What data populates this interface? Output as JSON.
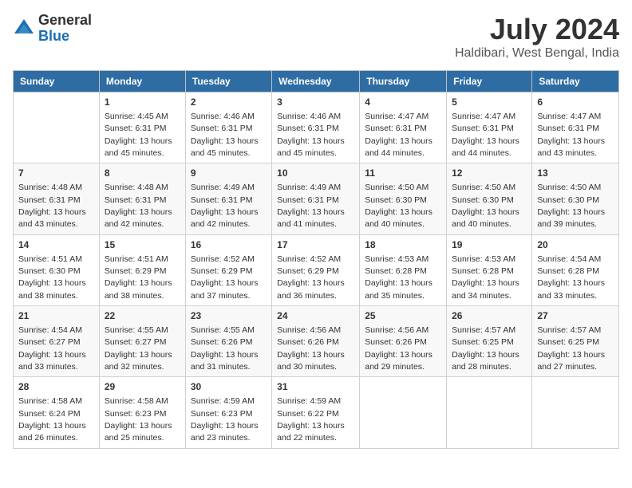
{
  "logo": {
    "general": "General",
    "blue": "Blue"
  },
  "title": "July 2024",
  "location": "Haldibari, West Bengal, India",
  "days_of_week": [
    "Sunday",
    "Monday",
    "Tuesday",
    "Wednesday",
    "Thursday",
    "Friday",
    "Saturday"
  ],
  "weeks": [
    [
      {
        "day": "",
        "info": ""
      },
      {
        "day": "1",
        "info": "Sunrise: 4:45 AM\nSunset: 6:31 PM\nDaylight: 13 hours\nand 45 minutes."
      },
      {
        "day": "2",
        "info": "Sunrise: 4:46 AM\nSunset: 6:31 PM\nDaylight: 13 hours\nand 45 minutes."
      },
      {
        "day": "3",
        "info": "Sunrise: 4:46 AM\nSunset: 6:31 PM\nDaylight: 13 hours\nand 45 minutes."
      },
      {
        "day": "4",
        "info": "Sunrise: 4:47 AM\nSunset: 6:31 PM\nDaylight: 13 hours\nand 44 minutes."
      },
      {
        "day": "5",
        "info": "Sunrise: 4:47 AM\nSunset: 6:31 PM\nDaylight: 13 hours\nand 44 minutes."
      },
      {
        "day": "6",
        "info": "Sunrise: 4:47 AM\nSunset: 6:31 PM\nDaylight: 13 hours\nand 43 minutes."
      }
    ],
    [
      {
        "day": "7",
        "info": "Sunrise: 4:48 AM\nSunset: 6:31 PM\nDaylight: 13 hours\nand 43 minutes."
      },
      {
        "day": "8",
        "info": "Sunrise: 4:48 AM\nSunset: 6:31 PM\nDaylight: 13 hours\nand 42 minutes."
      },
      {
        "day": "9",
        "info": "Sunrise: 4:49 AM\nSunset: 6:31 PM\nDaylight: 13 hours\nand 42 minutes."
      },
      {
        "day": "10",
        "info": "Sunrise: 4:49 AM\nSunset: 6:31 PM\nDaylight: 13 hours\nand 41 minutes."
      },
      {
        "day": "11",
        "info": "Sunrise: 4:50 AM\nSunset: 6:30 PM\nDaylight: 13 hours\nand 40 minutes."
      },
      {
        "day": "12",
        "info": "Sunrise: 4:50 AM\nSunset: 6:30 PM\nDaylight: 13 hours\nand 40 minutes."
      },
      {
        "day": "13",
        "info": "Sunrise: 4:50 AM\nSunset: 6:30 PM\nDaylight: 13 hours\nand 39 minutes."
      }
    ],
    [
      {
        "day": "14",
        "info": "Sunrise: 4:51 AM\nSunset: 6:30 PM\nDaylight: 13 hours\nand 38 minutes."
      },
      {
        "day": "15",
        "info": "Sunrise: 4:51 AM\nSunset: 6:29 PM\nDaylight: 13 hours\nand 38 minutes."
      },
      {
        "day": "16",
        "info": "Sunrise: 4:52 AM\nSunset: 6:29 PM\nDaylight: 13 hours\nand 37 minutes."
      },
      {
        "day": "17",
        "info": "Sunrise: 4:52 AM\nSunset: 6:29 PM\nDaylight: 13 hours\nand 36 minutes."
      },
      {
        "day": "18",
        "info": "Sunrise: 4:53 AM\nSunset: 6:28 PM\nDaylight: 13 hours\nand 35 minutes."
      },
      {
        "day": "19",
        "info": "Sunrise: 4:53 AM\nSunset: 6:28 PM\nDaylight: 13 hours\nand 34 minutes."
      },
      {
        "day": "20",
        "info": "Sunrise: 4:54 AM\nSunset: 6:28 PM\nDaylight: 13 hours\nand 33 minutes."
      }
    ],
    [
      {
        "day": "21",
        "info": "Sunrise: 4:54 AM\nSunset: 6:27 PM\nDaylight: 13 hours\nand 33 minutes."
      },
      {
        "day": "22",
        "info": "Sunrise: 4:55 AM\nSunset: 6:27 PM\nDaylight: 13 hours\nand 32 minutes."
      },
      {
        "day": "23",
        "info": "Sunrise: 4:55 AM\nSunset: 6:26 PM\nDaylight: 13 hours\nand 31 minutes."
      },
      {
        "day": "24",
        "info": "Sunrise: 4:56 AM\nSunset: 6:26 PM\nDaylight: 13 hours\nand 30 minutes."
      },
      {
        "day": "25",
        "info": "Sunrise: 4:56 AM\nSunset: 6:26 PM\nDaylight: 13 hours\nand 29 minutes."
      },
      {
        "day": "26",
        "info": "Sunrise: 4:57 AM\nSunset: 6:25 PM\nDaylight: 13 hours\nand 28 minutes."
      },
      {
        "day": "27",
        "info": "Sunrise: 4:57 AM\nSunset: 6:25 PM\nDaylight: 13 hours\nand 27 minutes."
      }
    ],
    [
      {
        "day": "28",
        "info": "Sunrise: 4:58 AM\nSunset: 6:24 PM\nDaylight: 13 hours\nand 26 minutes."
      },
      {
        "day": "29",
        "info": "Sunrise: 4:58 AM\nSunset: 6:23 PM\nDaylight: 13 hours\nand 25 minutes."
      },
      {
        "day": "30",
        "info": "Sunrise: 4:59 AM\nSunset: 6:23 PM\nDaylight: 13 hours\nand 23 minutes."
      },
      {
        "day": "31",
        "info": "Sunrise: 4:59 AM\nSunset: 6:22 PM\nDaylight: 13 hours\nand 22 minutes."
      },
      {
        "day": "",
        "info": ""
      },
      {
        "day": "",
        "info": ""
      },
      {
        "day": "",
        "info": ""
      }
    ]
  ]
}
